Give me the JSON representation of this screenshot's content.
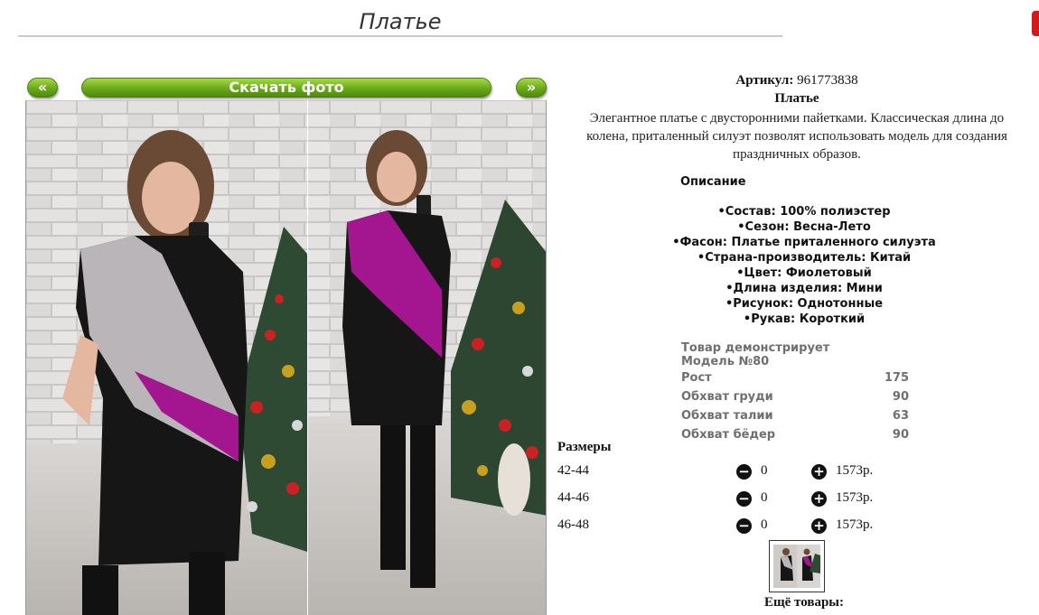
{
  "page": {
    "title": "Платье"
  },
  "gallery": {
    "prev_label": "«",
    "next_label": "»",
    "download_label": "Скачать фото",
    "image_alt": "Платье"
  },
  "product": {
    "article_label": "Артикул:",
    "article_value": "961773838",
    "name": "Платье",
    "description": "Элегантное платье с двусторонними пайетками. Классическая длина до колена, приталенный силуэт позволят использовать модель для создания праздничных образов."
  },
  "details": {
    "heading": "Описание",
    "items": [
      "Состав: 100% полиэстер",
      "Сезон: Весна-Лето",
      "Фасон: Платье приталенного силуэта",
      "Страна-производитель: Китай",
      "Цвет: Фиолетовый",
      "Длина изделия: Мини",
      "Рисунок: Однотонные",
      "Рукав: Короткий"
    ]
  },
  "model": {
    "rows": [
      {
        "label": "Товар демонстрирует Модель №80",
        "value": ""
      },
      {
        "label": "Рост",
        "value": "175"
      },
      {
        "label": "Обхват груди",
        "value": "90"
      },
      {
        "label": "Обхват талии",
        "value": "63"
      },
      {
        "label": "Обхват бёдер",
        "value": "90"
      }
    ]
  },
  "sizes": {
    "heading": "Размеры",
    "minus_icon": "−",
    "plus_icon": "+",
    "rows": [
      {
        "size": "42-44",
        "qty": "0",
        "price": "1573р."
      },
      {
        "size": "44-46",
        "qty": "0",
        "price": "1573р."
      },
      {
        "size": "46-48",
        "qty": "0",
        "price": "1573р."
      }
    ]
  },
  "more": {
    "title": "Ещё товары:"
  },
  "colors": {
    "button_green": "#6aa91a",
    "accent_red": "#d11a1a",
    "sequin_purple": "#a3168f",
    "dress_black": "#141414"
  }
}
